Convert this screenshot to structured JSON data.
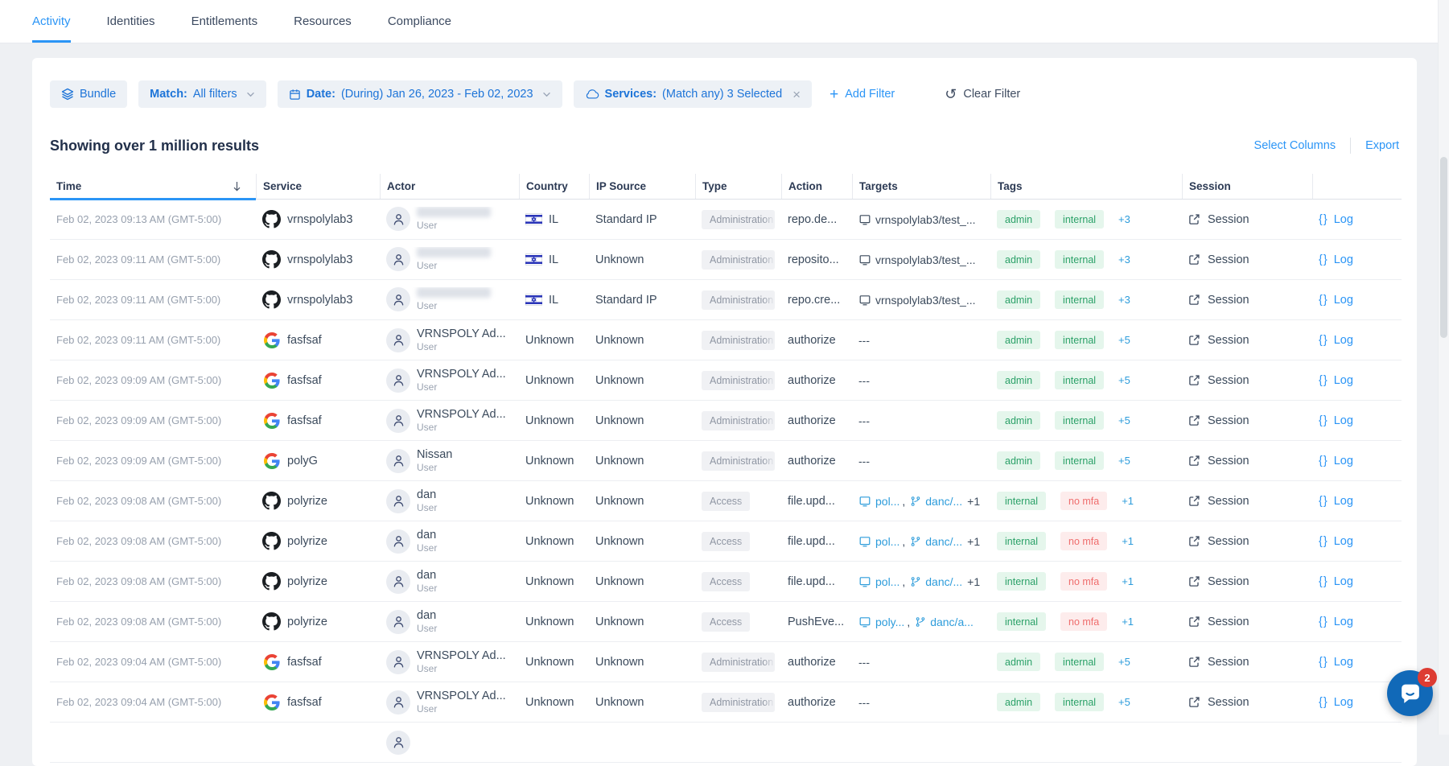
{
  "nav": {
    "tabs": [
      {
        "label": "Activity",
        "active": true
      },
      {
        "label": "Identities",
        "active": false
      },
      {
        "label": "Entitlements",
        "active": false
      },
      {
        "label": "Resources",
        "active": false
      },
      {
        "label": "Compliance",
        "active": false
      }
    ]
  },
  "filter_bar": {
    "bundle": {
      "label": "Bundle"
    },
    "match": {
      "label": "Match:",
      "value": "All filters"
    },
    "date": {
      "label": "Date:",
      "value": "(During) Jan 26, 2023 - Feb 02, 2023"
    },
    "services": {
      "label": "Services:",
      "value": "(Match any) 3 Selected"
    },
    "add_filter": "Add Filter",
    "clear_filter": "Clear Filter"
  },
  "results": {
    "summary": "Showing over 1 million results",
    "select_columns": "Select Columns",
    "export": "Export"
  },
  "icons": {
    "close": "×",
    "plus": "+",
    "undo": "↺",
    "braces": "{}"
  },
  "table": {
    "columns": [
      "Time",
      "Service",
      "Actor",
      "Country",
      "IP Source",
      "Type",
      "Action",
      "Targets",
      "Tags",
      "Session",
      ""
    ],
    "sorted_column": "Time",
    "sort_direction": "desc",
    "session_label": "Session",
    "log_label": "Log",
    "rows": [
      {
        "time": "Feb 02, 2023 09:13 AM (GMT-5:00)",
        "service": "vrnspolylab3",
        "service_icon": "github",
        "actor_redacted": true,
        "actor_sub": "User",
        "country": "IL",
        "country_flag": "israel",
        "ip_source": "Standard IP",
        "type": "Administration",
        "action": "repo.de...",
        "targets": [
          {
            "label": "vrnspolylab3/test_...",
            "icon": "device",
            "link": false
          }
        ],
        "tags": [
          {
            "label": "admin",
            "tone": "green"
          },
          {
            "label": "internal",
            "tone": "green"
          }
        ],
        "tags_more": "+3"
      },
      {
        "time": "Feb 02, 2023 09:11 AM (GMT-5:00)",
        "service": "vrnspolylab3",
        "service_icon": "github",
        "actor_redacted": true,
        "actor_sub": "User",
        "country": "IL",
        "country_flag": "israel",
        "ip_source": "Unknown",
        "type": "Administration",
        "action": "reposito...",
        "targets": [
          {
            "label": "vrnspolylab3/test_...",
            "icon": "device",
            "link": false
          }
        ],
        "tags": [
          {
            "label": "admin",
            "tone": "green"
          },
          {
            "label": "internal",
            "tone": "green"
          }
        ],
        "tags_more": "+3"
      },
      {
        "time": "Feb 02, 2023 09:11 AM (GMT-5:00)",
        "service": "vrnspolylab3",
        "service_icon": "github",
        "actor_redacted": true,
        "actor_sub": "User",
        "country": "IL",
        "country_flag": "israel",
        "ip_source": "Standard IP",
        "type": "Administration",
        "action": "repo.cre...",
        "targets": [
          {
            "label": "vrnspolylab3/test_...",
            "icon": "device",
            "link": false
          }
        ],
        "tags": [
          {
            "label": "admin",
            "tone": "green"
          },
          {
            "label": "internal",
            "tone": "green"
          }
        ],
        "tags_more": "+3"
      },
      {
        "time": "Feb 02, 2023 09:11 AM (GMT-5:00)",
        "service": "fasfsaf",
        "service_icon": "google",
        "actor": "VRNSPOLY Ad...",
        "actor_sub": "User",
        "country": "Unknown",
        "ip_source": "Unknown",
        "type": "Administration",
        "action": "authorize",
        "targets": "---",
        "tags": [
          {
            "label": "admin",
            "tone": "green"
          },
          {
            "label": "internal",
            "tone": "green"
          }
        ],
        "tags_more": "+5"
      },
      {
        "time": "Feb 02, 2023 09:09 AM (GMT-5:00)",
        "service": "fasfsaf",
        "service_icon": "google",
        "actor": "VRNSPOLY Ad...",
        "actor_sub": "User",
        "country": "Unknown",
        "ip_source": "Unknown",
        "type": "Administration",
        "action": "authorize",
        "targets": "---",
        "tags": [
          {
            "label": "admin",
            "tone": "green"
          },
          {
            "label": "internal",
            "tone": "green"
          }
        ],
        "tags_more": "+5"
      },
      {
        "time": "Feb 02, 2023 09:09 AM (GMT-5:00)",
        "service": "fasfsaf",
        "service_icon": "google",
        "actor": "VRNSPOLY Ad...",
        "actor_sub": "User",
        "country": "Unknown",
        "ip_source": "Unknown",
        "type": "Administration",
        "action": "authorize",
        "targets": "---",
        "tags": [
          {
            "label": "admin",
            "tone": "green"
          },
          {
            "label": "internal",
            "tone": "green"
          }
        ],
        "tags_more": "+5"
      },
      {
        "time": "Feb 02, 2023 09:09 AM (GMT-5:00)",
        "service": "polyG",
        "service_icon": "google",
        "actor": "Nissan",
        "actor_sub": "User",
        "country": "Unknown",
        "ip_source": "Unknown",
        "type": "Administration",
        "action": "authorize",
        "targets": "---",
        "tags": [
          {
            "label": "admin",
            "tone": "green"
          },
          {
            "label": "internal",
            "tone": "green"
          }
        ],
        "tags_more": "+5"
      },
      {
        "time": "Feb 02, 2023 09:08 AM (GMT-5:00)",
        "service": "polyrize",
        "service_icon": "github",
        "actor": "dan",
        "actor_sub": "User",
        "country": "Unknown",
        "ip_source": "Unknown",
        "type": "Access",
        "action": "file.upd...",
        "targets": [
          {
            "label": "pol...",
            "icon": "device",
            "link": true
          },
          {
            "label": "danc/...",
            "icon": "branch",
            "link": true
          }
        ],
        "targets_suffix": "+1",
        "tags": [
          {
            "label": "internal",
            "tone": "green"
          },
          {
            "label": "no mfa",
            "tone": "red"
          }
        ],
        "tags_more": "+1"
      },
      {
        "time": "Feb 02, 2023 09:08 AM (GMT-5:00)",
        "service": "polyrize",
        "service_icon": "github",
        "actor": "dan",
        "actor_sub": "User",
        "country": "Unknown",
        "ip_source": "Unknown",
        "type": "Access",
        "action": "file.upd...",
        "targets": [
          {
            "label": "pol...",
            "icon": "device",
            "link": true
          },
          {
            "label": "danc/...",
            "icon": "branch",
            "link": true
          }
        ],
        "targets_suffix": "+1",
        "tags": [
          {
            "label": "internal",
            "tone": "green"
          },
          {
            "label": "no mfa",
            "tone": "red"
          }
        ],
        "tags_more": "+1"
      },
      {
        "time": "Feb 02, 2023 09:08 AM (GMT-5:00)",
        "service": "polyrize",
        "service_icon": "github",
        "actor": "dan",
        "actor_sub": "User",
        "country": "Unknown",
        "ip_source": "Unknown",
        "type": "Access",
        "action": "file.upd...",
        "targets": [
          {
            "label": "pol...",
            "icon": "device",
            "link": true
          },
          {
            "label": "danc/...",
            "icon": "branch",
            "link": true
          }
        ],
        "targets_suffix": "+1",
        "tags": [
          {
            "label": "internal",
            "tone": "green"
          },
          {
            "label": "no mfa",
            "tone": "red"
          }
        ],
        "tags_more": "+1"
      },
      {
        "time": "Feb 02, 2023 09:08 AM (GMT-5:00)",
        "service": "polyrize",
        "service_icon": "github",
        "actor": "dan",
        "actor_sub": "User",
        "country": "Unknown",
        "ip_source": "Unknown",
        "type": "Access",
        "action": "PushEve...",
        "targets": [
          {
            "label": "poly...",
            "icon": "device",
            "link": true
          },
          {
            "label": "danc/a...",
            "icon": "branch",
            "link": true
          }
        ],
        "tags": [
          {
            "label": "internal",
            "tone": "green"
          },
          {
            "label": "no mfa",
            "tone": "red"
          }
        ],
        "tags_more": "+1"
      },
      {
        "time": "Feb 02, 2023 09:04 AM (GMT-5:00)",
        "service": "fasfsaf",
        "service_icon": "google",
        "actor": "VRNSPOLY Ad...",
        "actor_sub": "User",
        "country": "Unknown",
        "ip_source": "Unknown",
        "type": "Administration",
        "action": "authorize",
        "targets": "---",
        "tags": [
          {
            "label": "admin",
            "tone": "green"
          },
          {
            "label": "internal",
            "tone": "green"
          }
        ],
        "tags_more": "+5"
      },
      {
        "time": "Feb 02, 2023 09:04 AM (GMT-5:00)",
        "service": "fasfsaf",
        "service_icon": "google",
        "actor": "VRNSPOLY Ad...",
        "actor_sub": "User",
        "country": "Unknown",
        "ip_source": "Unknown",
        "type": "Administration",
        "action": "authorize",
        "targets": "---",
        "tags": [
          {
            "label": "admin",
            "tone": "green"
          },
          {
            "label": "internal",
            "tone": "green"
          }
        ],
        "tags_more": "+5"
      },
      {
        "partial": true
      }
    ]
  },
  "chat_widget": {
    "unread_count": "2"
  },
  "colors": {
    "accent_blue": "#2b95f6",
    "filter_blue": "#1d74d8",
    "tag_green": "#2ba168",
    "tag_red": "#ef6d6d",
    "link_blue": "#2d9cdb",
    "chat_blue": "#1169b8",
    "badge_red": "#dd3c33"
  }
}
